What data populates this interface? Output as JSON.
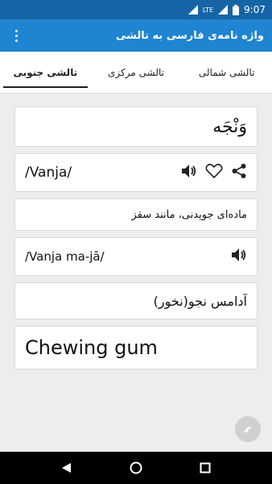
{
  "status_bar": {
    "network": "LTE",
    "time": "9:07"
  },
  "app_bar": {
    "title": "واژه نامه‌ی فارسی به تالشی",
    "menu_icon": "more-vert-icon"
  },
  "tabs": [
    {
      "label": "تالشی شمالی",
      "active": false
    },
    {
      "label": "تالشی مرکزی",
      "active": false
    },
    {
      "label": "تالشی جنوبی",
      "active": true
    }
  ],
  "entry": {
    "word": "وَنْجَه",
    "pronunciation": "/Vanja/",
    "meaning": "ماده‌ای جویدنی، مانند سقز",
    "example_pronunciation": "/Vanja ma-jā/",
    "example_persian": "آدامس نجو(نخور)",
    "english": "Chewing gum"
  },
  "icons": {
    "share": "share-icon",
    "favorite": "heart-outline-icon",
    "speaker": "volume-icon"
  },
  "colors": {
    "status_bar": "#1565a6",
    "app_bar": "#1f84d1",
    "background": "#ededed"
  }
}
